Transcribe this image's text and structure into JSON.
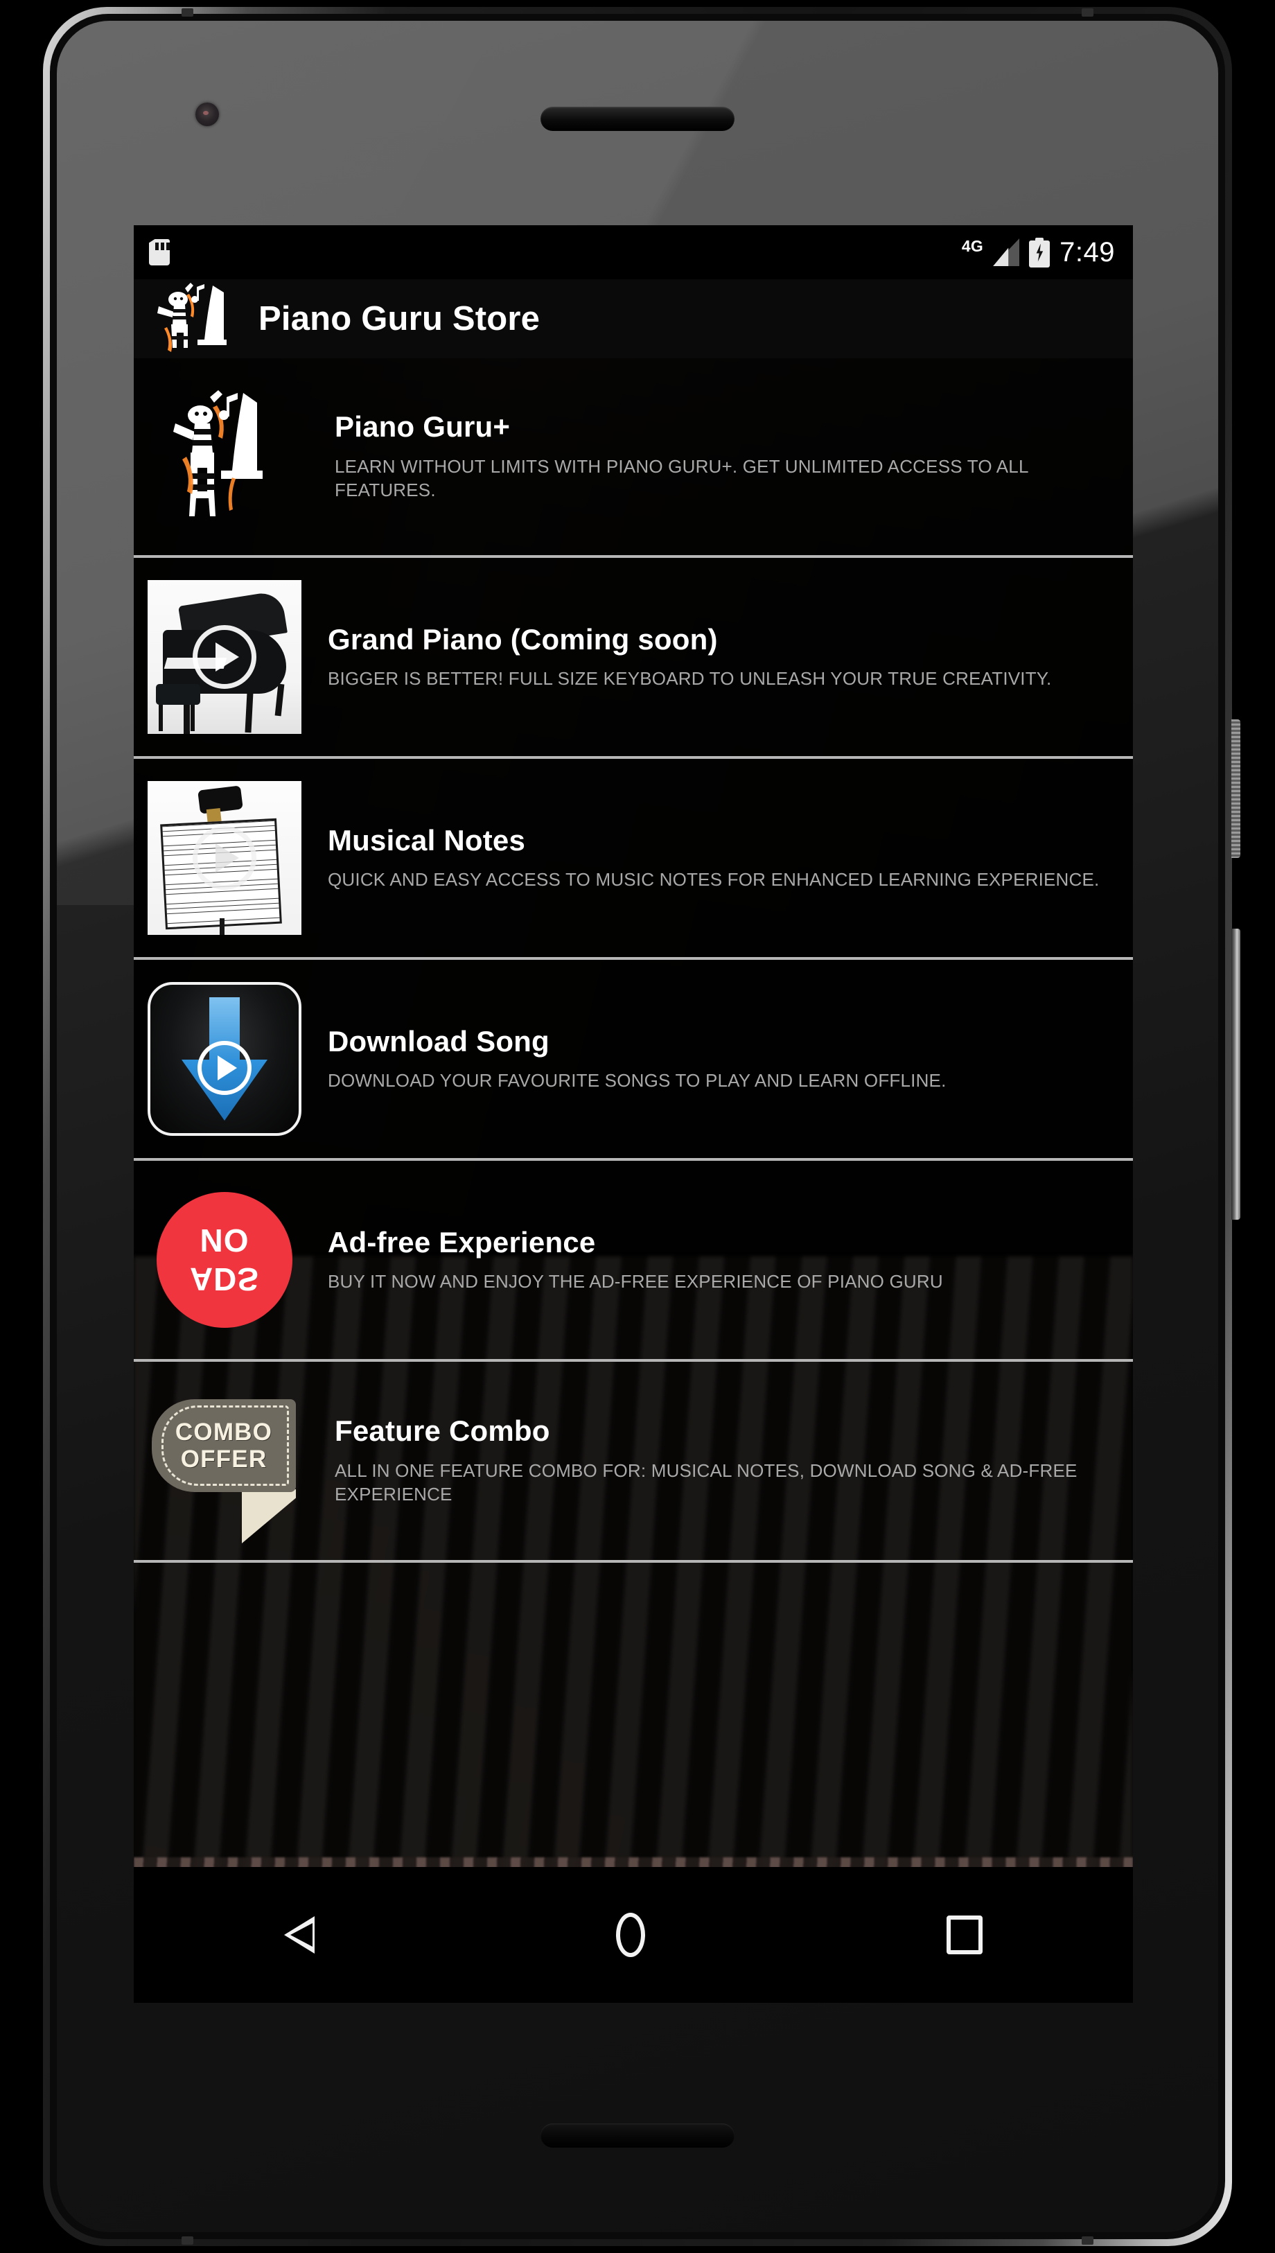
{
  "device": {
    "kind": "android-phone-mockup",
    "hardware_buttons": [
      "power-button",
      "volume-rocker"
    ]
  },
  "status_bar": {
    "sd_card_icon": "sd-card-icon",
    "network_label": "4G",
    "signal_icon": "signal-bars-icon",
    "battery_icon": "battery-charging-icon",
    "time": "7:49"
  },
  "app_bar": {
    "logo_icon": "piano-guru-mascot-logo",
    "title": "Piano Guru Store"
  },
  "store_items": [
    {
      "id": "piano-guru-plus",
      "thumb": "piano-guru-mascot-logo",
      "thumb_kind": "mascot",
      "has_play_overlay": false,
      "title": "Piano Guru+",
      "description": "LEARN WITHOUT LIMITS WITH PIANO GURU+. GET UNLIMITED ACCESS TO ALL FEATURES."
    },
    {
      "id": "grand-piano",
      "thumb": "grand-piano-photo",
      "thumb_kind": "grand-piano",
      "has_play_overlay": true,
      "title": "Grand Piano (Coming soon)",
      "description": "BIGGER IS BETTER! FULL SIZE KEYBOARD TO UNLEASH YOUR TRUE CREATIVITY."
    },
    {
      "id": "musical-notes",
      "thumb": "sheet-music-stand-photo",
      "thumb_kind": "musical-notes",
      "has_play_overlay": true,
      "title": "Musical Notes",
      "description": "QUICK AND EASY ACCESS TO MUSIC NOTES FOR ENHANCED LEARNING EXPERIENCE."
    },
    {
      "id": "download-song",
      "thumb": "download-arrow-icon",
      "thumb_kind": "download",
      "has_play_overlay": false,
      "title": "Download Song",
      "description": "DOWNLOAD YOUR FAVOURITE SONGS TO PLAY AND LEARN OFFLINE."
    },
    {
      "id": "ad-free-experience",
      "thumb": "no-ads-badge-icon",
      "thumb_kind": "noads",
      "has_play_overlay": false,
      "badge_line_1": "NO",
      "badge_line_2": "ADS",
      "title": "Ad-free Experience",
      "description": "BUY IT NOW AND ENJOY THE AD-FREE EXPERIENCE OF PIANO GURU"
    },
    {
      "id": "feature-combo",
      "thumb": "combo-offer-badge-icon",
      "thumb_kind": "combo",
      "has_play_overlay": false,
      "badge_line_1": "COMBO",
      "badge_line_2": "OFFER",
      "title": "Feature Combo",
      "description": "ALL IN ONE FEATURE COMBO FOR: MUSICAL NOTES, DOWNLOAD SONG & AD-FREE EXPERIENCE"
    }
  ],
  "nav_bar": {
    "back": "back-nav-icon",
    "home": "home-nav-icon",
    "recents": "recents-nav-icon"
  },
  "colors": {
    "screen_background": "#050505",
    "status_bar_background": "#000000",
    "title_text": "#ffffff",
    "description_text": "#a9a9a9",
    "divider": "#b6b6b6",
    "no_ads_red": "#f0353f",
    "combo_tag_grey": "#6f6a60",
    "download_blue": "#2e8fd8"
  }
}
